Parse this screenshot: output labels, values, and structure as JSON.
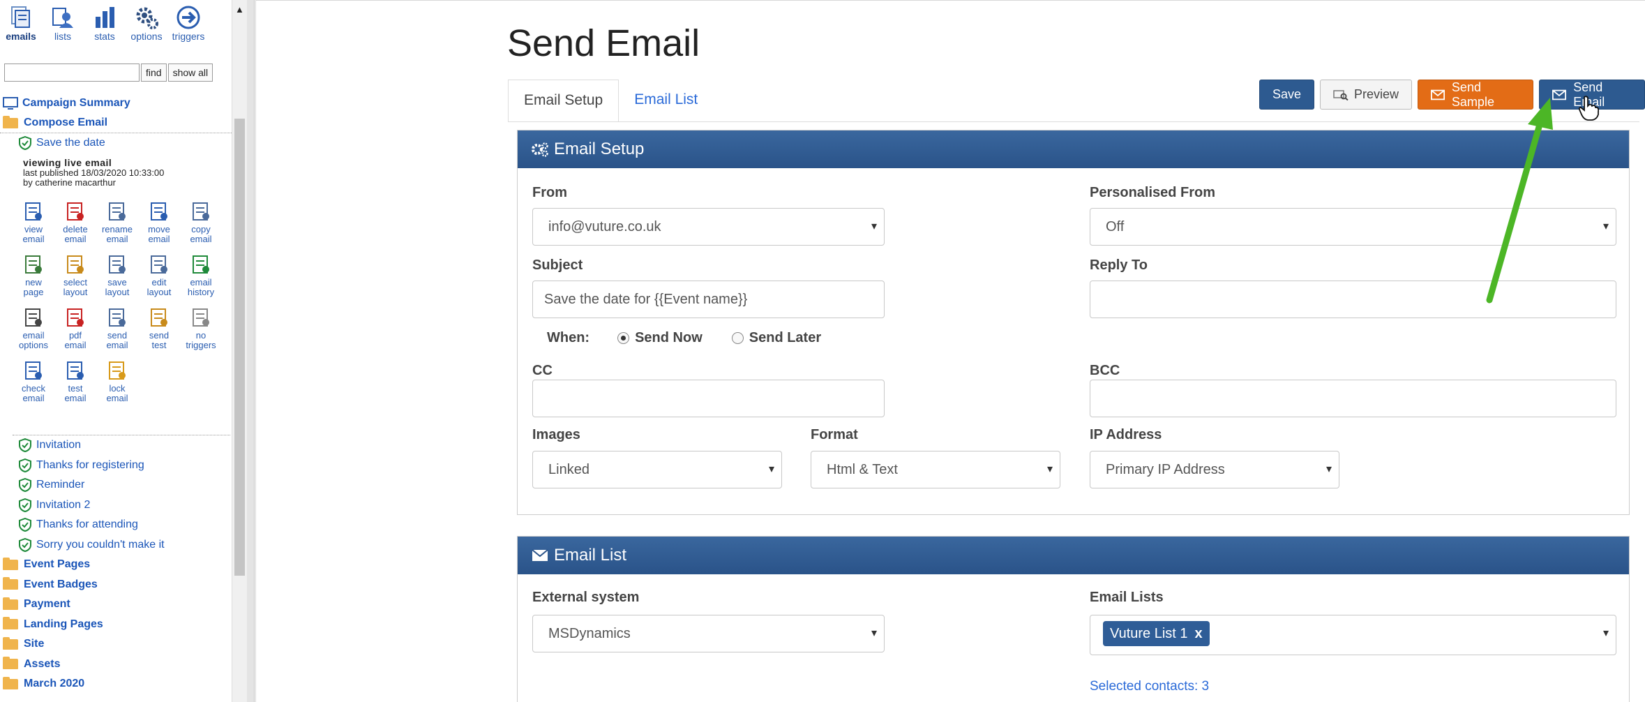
{
  "sidebar": {
    "top_icons": [
      {
        "label": "emails",
        "icon": "emails-icon"
      },
      {
        "label": "lists",
        "icon": "lists-icon"
      },
      {
        "label": "stats",
        "icon": "stats-icon"
      },
      {
        "label": "options",
        "icon": "options-gear-icon"
      },
      {
        "label": "triggers",
        "icon": "triggers-arrow-icon"
      }
    ],
    "search": {
      "value": "",
      "find_label": "find",
      "show_all_label": "show all"
    },
    "campaign_summary": "Campaign Summary",
    "compose_email": "Compose Email",
    "current_email": "Save the date",
    "viewing": "viewing  live  email",
    "last_published": "last published 18/03/2020 10:33:00",
    "published_by": "by catherine macarthur",
    "actions": [
      [
        "view",
        "email"
      ],
      [
        "delete",
        "email"
      ],
      [
        "rename",
        "email"
      ],
      [
        "move",
        "email"
      ],
      [
        "copy",
        "email"
      ],
      [
        "new",
        "page"
      ],
      [
        "select",
        "layout"
      ],
      [
        "save",
        "layout"
      ],
      [
        "edit",
        "layout"
      ],
      [
        "email",
        "history"
      ],
      [
        "email",
        "options"
      ],
      [
        "pdf",
        "email"
      ],
      [
        "send",
        "email"
      ],
      [
        "send",
        "test"
      ],
      [
        "no",
        "triggers"
      ],
      [
        "check",
        "email"
      ],
      [
        "test",
        "email"
      ],
      [
        "lock",
        "email"
      ]
    ],
    "other_emails": [
      "Invitation",
      "Thanks for registering",
      "Reminder",
      "Invitation 2",
      "Thanks for attending",
      "Sorry you couldn't make it"
    ],
    "folders": [
      "Event Pages",
      "Event Badges",
      "Payment",
      "Landing Pages",
      "Site",
      "Assets",
      "March 2020"
    ]
  },
  "main": {
    "title": "Send Email",
    "tabs": [
      "Email Setup",
      "Email List"
    ],
    "buttons": {
      "save": "Save",
      "preview": "Preview",
      "send_sample": "Send Sample",
      "send_email": "Send Email"
    },
    "setup_panel": {
      "title": "Email Setup",
      "from_label": "From",
      "from_value": "info@vuture.co.uk",
      "personalised_label": "Personalised From",
      "personalised_value": "Off",
      "subject_label": "Subject",
      "subject_value": "Save the date for {{Event name}}",
      "reply_to_label": "Reply To",
      "reply_to_value": "",
      "when_label": "When:",
      "send_now": "Send Now",
      "send_later": "Send Later",
      "cc_label": "CC",
      "bcc_label": "BCC",
      "images_label": "Images",
      "images_value": "Linked",
      "format_label": "Format",
      "format_value": "Html & Text",
      "ip_label": "IP Address",
      "ip_value": "Primary IP Address"
    },
    "list_panel": {
      "title": "Email List",
      "external_label": "External system",
      "external_value": "MSDynamics",
      "lists_label": "Email Lists",
      "list_tag": "Vuture List 1",
      "selected_contacts": "Selected contacts: 3"
    }
  },
  "colors": {
    "header_blue": "#2d5a90",
    "orange": "#e36c16",
    "link_blue": "#2a6ad8",
    "arrow_green": "#4cb626"
  }
}
